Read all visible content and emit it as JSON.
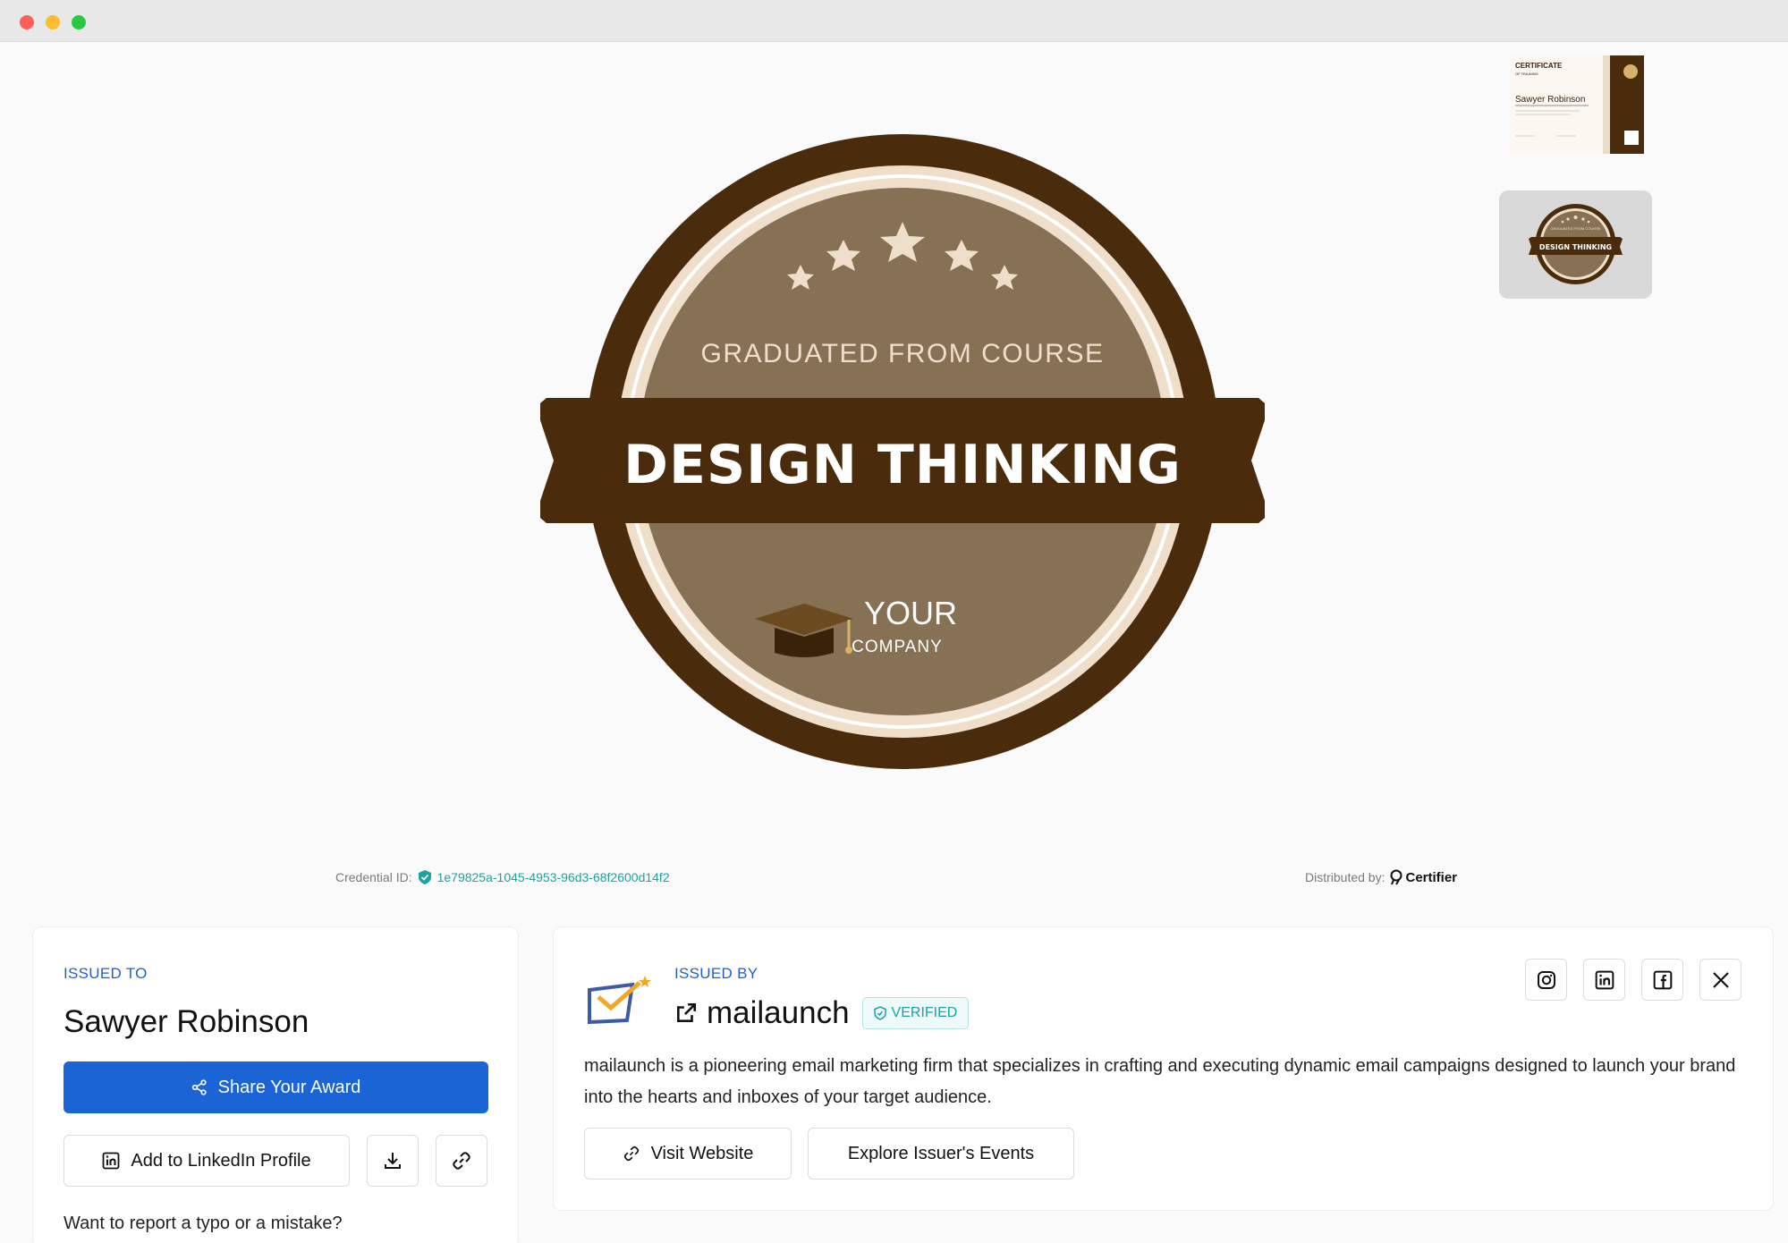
{
  "window": {
    "controls": [
      "close",
      "minimize",
      "maximize"
    ]
  },
  "badge": {
    "top_text": "GRADUATED FROM COURSE",
    "title": "DESIGN THINKING",
    "company_line1": "YOUR",
    "company_line2": "COMPANY",
    "colors": {
      "outer": "#4a2c0d",
      "ring": "#efdfca",
      "inner": "#867154",
      "stars": "#efdfca"
    }
  },
  "thumbnails": {
    "certificate": {
      "title": "CERTIFICATE",
      "subtitle": "OF TRAINING",
      "name": "Sawyer Robinson"
    },
    "badge": {
      "top_text": "GRADUATED FROM COURSE",
      "title": "DESIGN THINKING"
    }
  },
  "credential": {
    "label": "Credential ID:",
    "id": "1e79825a-1045-4953-96d3-68f2600d14f2",
    "distributed_label": "Distributed by:",
    "distributor": "Certifier"
  },
  "issued_to": {
    "label": "ISSUED TO",
    "name": "Sawyer Robinson",
    "share_label": "Share Your Award",
    "linkedin_label": "Add to LinkedIn Profile",
    "report_text": "Want to report a typo or a mistake?"
  },
  "issued_by": {
    "label": "ISSUED BY",
    "name": "mailaunch",
    "verified_label": "VERIFIED",
    "description": "mailaunch is a pioneering email marketing firm that specializes in crafting and executing dynamic email campaigns designed to launch your brand into the hearts and inboxes of your target audience.",
    "visit_label": "Visit Website",
    "events_label": "Explore Issuer's Events",
    "social": [
      "instagram-icon",
      "linkedin-icon",
      "facebook-icon",
      "x-icon"
    ]
  },
  "colors": {
    "accent": "#1a64d6",
    "teal": "#1aa3a3",
    "label_blue": "#1f5fd1"
  }
}
